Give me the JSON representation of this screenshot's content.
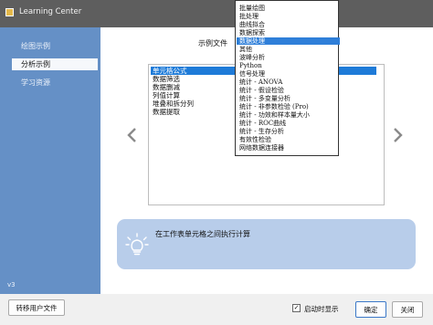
{
  "window": {
    "title": "Learning Center",
    "icon": "app-icon"
  },
  "sidebar": {
    "items": [
      {
        "label": "绘图示例",
        "active": false
      },
      {
        "label": "分析示例",
        "active": true
      },
      {
        "label": "学习资源",
        "active": false
      }
    ],
    "version": "v3"
  },
  "main": {
    "section_title": "示例文件",
    "files": [
      "单元格公式",
      "数据筛选",
      "数据删减",
      "列值计算",
      "堆叠和拆分列",
      "数据提取"
    ],
    "selected_index": 0,
    "prev_icon": "chevron-left-icon",
    "next_icon": "chevron-right-icon"
  },
  "info": {
    "text": "在工作表单元格之间执行计算",
    "icon": "lightbulb-icon"
  },
  "bottom": {
    "migrate_label": "转移用户文件",
    "show_on_start_label": "启动时显示",
    "show_on_start_checked": true,
    "ok_label": "确定",
    "close_label": "关闭"
  },
  "dropdown": {
    "items": [
      "批量绘图",
      "批处理",
      "曲线拟合",
      "数据探索",
      "数据处理",
      "其他",
      "波峰分析",
      "Python",
      "信号处理",
      "统计 - ANOVA",
      "统计 - 假设检验",
      "统计 - 多变量分析",
      "统计 - 非参数检验 (Pro)",
      "统计 - 功效和样本量大小",
      "统计 - ROC曲线",
      "统计 - 生存分析",
      "有效性检验",
      "网络数据连接器"
    ],
    "highlighted_index": 4
  },
  "colors": {
    "sidebar": "#6590c6",
    "selection": "#1e7bd8",
    "info_panel": "#b8cdea",
    "titlebar": "#5e5e5e"
  }
}
